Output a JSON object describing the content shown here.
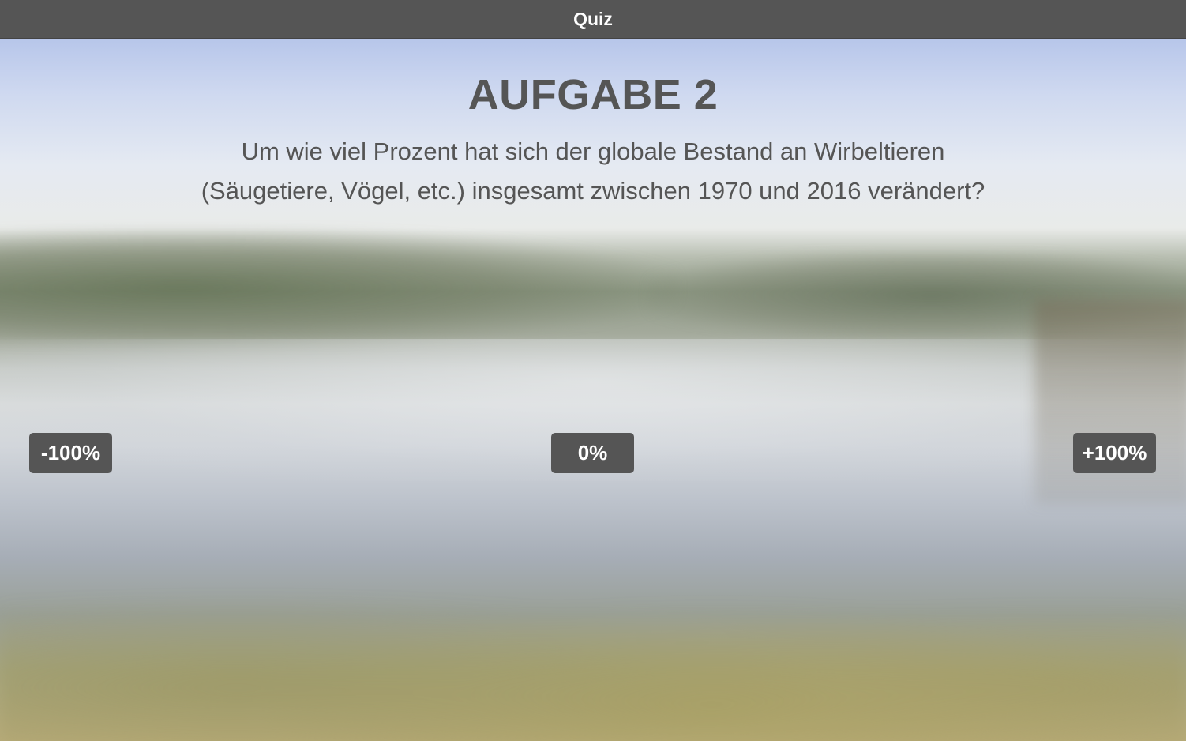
{
  "window": {
    "title": "Quiz"
  },
  "task": {
    "title": "AUFGABE 2",
    "question_line1": "Um wie viel Prozent hat sich der globale Bestand an Wirbeltieren",
    "question_line2": "(Säugetiere, Vögel, etc.) insgesamt  zwischen 1970 und 2016 verändert?"
  },
  "slider": {
    "min_label": "-100%",
    "mid_label": "0%",
    "max_label": "+100%"
  },
  "colors": {
    "bar": "#555555",
    "text": "#555555",
    "button_text": "#ffffff"
  }
}
